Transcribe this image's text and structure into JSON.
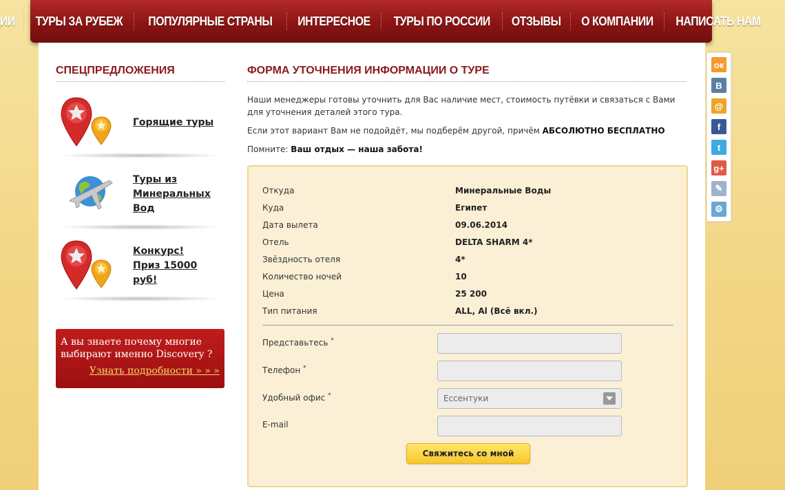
{
  "nav": {
    "items": [
      "АКЦИИ",
      "ТУРЫ ЗА РУБЕЖ",
      "ПОПУЛЯРНЫЕ СТРАНЫ",
      "ИНТЕРЕСНОЕ",
      "ТУРЫ ПО РОССИИ",
      "ОТЗЫВЫ",
      "О КОМПАНИИ",
      "НАПИСАТЬ НАМ"
    ]
  },
  "sidebar": {
    "title": "СПЕЦПРЕДЛОЖЕНИЯ",
    "items": [
      {
        "line1": "Горящие туры",
        "line2": "",
        "icon": "map-pin-star-icon"
      },
      {
        "line1": "Туры из",
        "line2": "Минеральных Вод",
        "icon": "plane-globe-icon"
      },
      {
        "line1": "Конкурс!",
        "line2": "Приз 15000 руб!",
        "icon": "map-pin-star-icon"
      }
    ],
    "banner": {
      "text": "А вы знаете почему многие выбирают именно Discovery ?",
      "link": "Узнать подробности » » »"
    }
  },
  "main": {
    "title": "ФОРМА УТОЧНЕНИЯ ИНФОРМАЦИИ О ТУРЕ",
    "intro1": "Наши менеджеры готовы уточнить для Вас наличие мест, стоимость путёвки и связаться с Вами для уточнения деталей этого тура.",
    "intro2_prefix": "Если этот вариант Вам не подойдёт, мы подберём другой, причём ",
    "intro2_bold": "АБСОЛЮТНО БЕСПЛАТНО",
    "intro3_prefix": "Помните: ",
    "intro3_bold": "Ваш отдых — наша забота!",
    "info": [
      {
        "label": "Откуда",
        "value": "Минеральные Воды"
      },
      {
        "label": "Куда",
        "value": "Египет"
      },
      {
        "label": "Дата вылета",
        "value": "09.06.2014"
      },
      {
        "label": "Отель",
        "value": "DELTA SHARM 4*"
      },
      {
        "label": "Звёздность отеля",
        "value": "4*"
      },
      {
        "label": "Количество ночей",
        "value": "10"
      },
      {
        "label": "Цена",
        "value": "25 200"
      },
      {
        "label": "Тип питания",
        "value": "ALL, Al (Всё вкл.)"
      }
    ],
    "form": {
      "name_label": "Представьтесь",
      "phone_label": "Телефон",
      "office_label": "Удобный офис",
      "office_value": "Ессентуки",
      "email_label": "E-mail",
      "required_mark": "*",
      "submit_label": "Свяжитесь со мной"
    }
  },
  "share": {
    "buttons": [
      {
        "icon": "odnoklassniki-icon",
        "glyph": "ок",
        "color": "#f59a2a"
      },
      {
        "icon": "vkontakte-icon",
        "glyph": "В",
        "color": "#5b7fa6"
      },
      {
        "icon": "mailru-icon",
        "glyph": "@",
        "color": "#f0a329"
      },
      {
        "icon": "facebook-icon",
        "glyph": "f",
        "color": "#3b5998"
      },
      {
        "icon": "twitter-icon",
        "glyph": "t",
        "color": "#3fa9e0"
      },
      {
        "icon": "google-plus-icon",
        "glyph": "g+",
        "color": "#e05a44"
      },
      {
        "icon": "bookmark-icon",
        "glyph": "✎",
        "color": "#9fb3cc"
      },
      {
        "icon": "settings-icon",
        "glyph": "⚙",
        "color": "#6aa7d4"
      }
    ]
  }
}
